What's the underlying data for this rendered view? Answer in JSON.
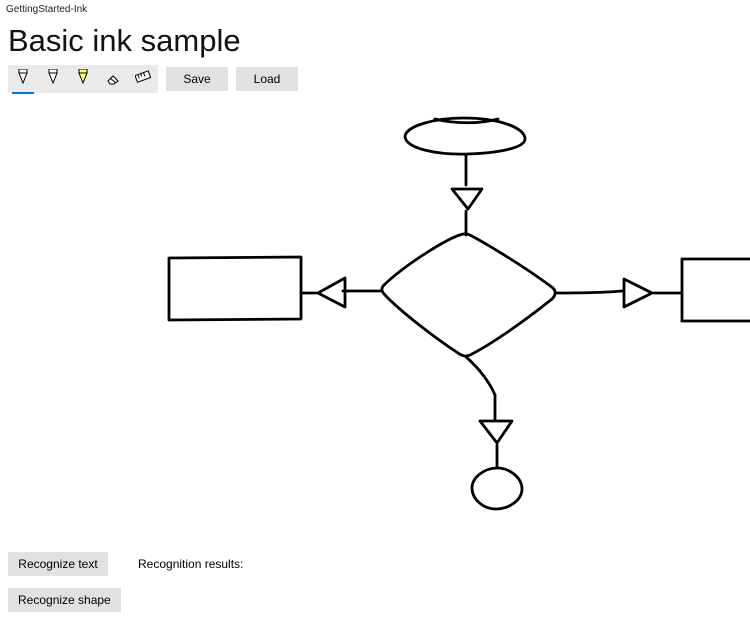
{
  "window": {
    "title": "GettingStarted-Ink"
  },
  "header": {
    "title": "Basic ink sample"
  },
  "toolbar": {
    "tools": [
      {
        "name": "ballpoint-pen",
        "icon": "pen-nib",
        "selected": true,
        "color": "#000000",
        "fill": "#ffffff"
      },
      {
        "name": "pencil",
        "icon": "pen-nib",
        "selected": false,
        "color": "#000000",
        "fill": "#ffffff"
      },
      {
        "name": "highlighter",
        "icon": "pen-nib",
        "selected": false,
        "color": "#000000",
        "fill": "#ffff66"
      },
      {
        "name": "eraser",
        "icon": "eraser",
        "selected": false,
        "color": "#000000",
        "fill": "#ffffff"
      },
      {
        "name": "ruler",
        "icon": "ruler",
        "selected": false,
        "color": "#000000",
        "fill": "#ffffff"
      }
    ],
    "save_label": "Save",
    "load_label": "Load"
  },
  "recognition": {
    "recognize_text_label": "Recognize text",
    "recognize_shape_label": "Recognize shape",
    "results_label": "Recognition results:",
    "results_value": ""
  },
  "ink_strokes": {
    "description": "Hand-drawn flowchart: ellipse at top with arrow down to a diamond; diamond has arrows to left rectangle, right rectangle (partially off-canvas), and down to a small circle.",
    "stroke_color": "#000000"
  }
}
